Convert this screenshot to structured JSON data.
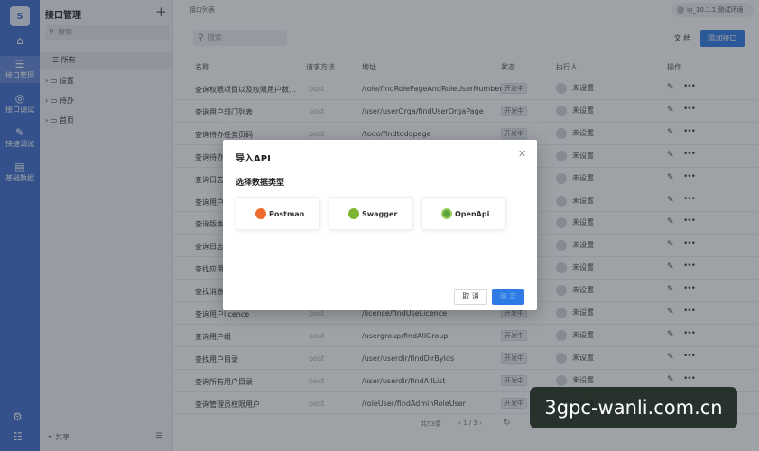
{
  "rail": {
    "logo": "S",
    "items": [
      {
        "icon": "home-icon",
        "glyph": "⌂",
        "label": ""
      },
      {
        "icon": "sliders-icon",
        "glyph": "☰",
        "label": "接口管理"
      },
      {
        "icon": "target-icon",
        "glyph": "◎",
        "label": "接口调试"
      },
      {
        "icon": "wrench-icon",
        "glyph": "✎",
        "label": "快捷调试"
      },
      {
        "icon": "database-icon",
        "glyph": "▤",
        "label": "基础数据"
      }
    ],
    "bottom_icons": [
      "settings-icon",
      "menu-icon"
    ]
  },
  "tree": {
    "title": "接口管理",
    "search_placeholder": "搜索",
    "all_label": "所有",
    "nodes": [
      "设置",
      "待办",
      "首页"
    ],
    "footer_label": "共享"
  },
  "main": {
    "breadcrumb": "接口列表",
    "env_label": "ip_10.1.1.测试环境",
    "search_placeholder": "搜索",
    "doc_button": "文 档",
    "add_button": "添加接口",
    "columns": [
      "名称",
      "请求方法",
      "地址",
      "状态",
      "执行人",
      "操作"
    ],
    "rows": [
      {
        "name": "查询权限项目以及权限用户数...",
        "method": "post",
        "path": "/role/findRolePageAndRoleUserNumber",
        "status": "开发中",
        "exec": "未设置"
      },
      {
        "name": "查询用户部门列表",
        "method": "post",
        "path": "/user/userOrga/findUserOrgaPage",
        "status": "开发中",
        "exec": "未设置"
      },
      {
        "name": "查询待办任务页码",
        "method": "post",
        "path": "/todo/findtodopage",
        "status": "开发中",
        "exec": "未设置"
      },
      {
        "name": "查询待办",
        "method": "post",
        "path": "",
        "status": "开发中",
        "exec": "未设置"
      },
      {
        "name": "查询日志",
        "method": "post",
        "path": "",
        "status": "开发中",
        "exec": "未设置"
      },
      {
        "name": "查询用户",
        "method": "post",
        "path": "",
        "status": "开发中",
        "exec": "未设置"
      },
      {
        "name": "查询版本",
        "method": "post",
        "path": "",
        "status": "开发中",
        "exec": "未设置"
      },
      {
        "name": "查询日志",
        "method": "post",
        "path": "",
        "status": "开发中",
        "exec": "未设置"
      },
      {
        "name": "查找应用",
        "method": "post",
        "path": "",
        "status": "开发中",
        "exec": "未设置"
      },
      {
        "name": "查找消息",
        "method": "post",
        "path": "",
        "status": "开发中",
        "exec": "未设置"
      },
      {
        "name": "查询用户licence",
        "method": "post",
        "path": "/licence/findUseLicence",
        "status": "开发中",
        "exec": "未设置"
      },
      {
        "name": "查询用户组",
        "method": "post",
        "path": "/usergroup/findAllGroup",
        "status": "开发中",
        "exec": "未设置"
      },
      {
        "name": "查找用户目录",
        "method": "post",
        "path": "/user/userdir/findDirByIds",
        "status": "开发中",
        "exec": "未设置"
      },
      {
        "name": "查询所有用户目录",
        "method": "post",
        "path": "/user/userdir/findAllList",
        "status": "开发中",
        "exec": "未设置"
      },
      {
        "name": "查询管理员权限用户",
        "method": "post",
        "path": "/roleUser/findAdminRoleUser",
        "status": "开发中",
        "exec": "未设置"
      }
    ],
    "pager_prefix": "共53条",
    "pager_text": "‹ 1 / 3 ›"
  },
  "modal": {
    "title": "导入API",
    "subtitle": "选择数据类型",
    "options": [
      "Postman",
      "Swagger",
      "OpenApi"
    ],
    "cancel": "取 消",
    "ok": "确 定"
  },
  "watermark": "3gpc-wanli.com.cn"
}
